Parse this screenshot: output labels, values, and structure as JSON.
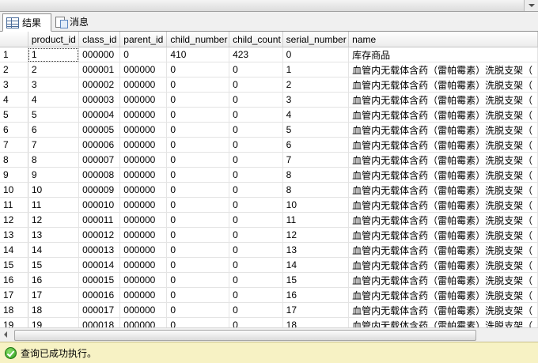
{
  "tabs": [
    {
      "label": "结果",
      "icon": "grid-icon",
      "active": true
    },
    {
      "label": "消息",
      "icon": "message-icon",
      "active": false
    }
  ],
  "results": {
    "columns": [
      "product_id",
      "class_id",
      "parent_id",
      "child_number",
      "child_count",
      "serial_number",
      "name"
    ],
    "rows": [
      [
        "1",
        "1",
        "000000",
        "0",
        "410",
        "423",
        "0",
        "库存商品"
      ],
      [
        "2",
        "2",
        "000001",
        "000000",
        "0",
        "0",
        "1",
        "血管内无载体含药（雷帕霉素）洗脱支架（"
      ],
      [
        "3",
        "3",
        "000002",
        "000000",
        "0",
        "0",
        "2",
        "血管内无载体含药（雷帕霉素）洗脱支架（"
      ],
      [
        "4",
        "4",
        "000003",
        "000000",
        "0",
        "0",
        "3",
        "血管内无载体含药（雷帕霉素）洗脱支架（"
      ],
      [
        "5",
        "5",
        "000004",
        "000000",
        "0",
        "0",
        "4",
        "血管内无载体含药（雷帕霉素）洗脱支架（"
      ],
      [
        "6",
        "6",
        "000005",
        "000000",
        "0",
        "0",
        "5",
        "血管内无载体含药（雷帕霉素）洗脱支架（"
      ],
      [
        "7",
        "7",
        "000006",
        "000000",
        "0",
        "0",
        "6",
        "血管内无载体含药（雷帕霉素）洗脱支架（"
      ],
      [
        "8",
        "8",
        "000007",
        "000000",
        "0",
        "0",
        "7",
        "血管内无载体含药（雷帕霉素）洗脱支架（"
      ],
      [
        "9",
        "9",
        "000008",
        "000000",
        "0",
        "0",
        "8",
        "血管内无载体含药（雷帕霉素）洗脱支架（"
      ],
      [
        "10",
        "10",
        "000009",
        "000000",
        "0",
        "0",
        "8",
        "血管内无载体含药（雷帕霉素）洗脱支架（"
      ],
      [
        "11",
        "11",
        "000010",
        "000000",
        "0",
        "0",
        "10",
        "血管内无载体含药（雷帕霉素）洗脱支架（"
      ],
      [
        "12",
        "12",
        "000011",
        "000000",
        "0",
        "0",
        "11",
        "血管内无载体含药（雷帕霉素）洗脱支架（"
      ],
      [
        "13",
        "13",
        "000012",
        "000000",
        "0",
        "0",
        "12",
        "血管内无载体含药（雷帕霉素）洗脱支架（"
      ],
      [
        "14",
        "14",
        "000013",
        "000000",
        "0",
        "0",
        "13",
        "血管内无载体含药（雷帕霉素）洗脱支架（"
      ],
      [
        "15",
        "15",
        "000014",
        "000000",
        "0",
        "0",
        "14",
        "血管内无载体含药（雷帕霉素）洗脱支架（"
      ],
      [
        "16",
        "16",
        "000015",
        "000000",
        "0",
        "0",
        "15",
        "血管内无载体含药（雷帕霉素）洗脱支架（"
      ],
      [
        "17",
        "17",
        "000016",
        "000000",
        "0",
        "0",
        "16",
        "血管内无载体含药（雷帕霉素）洗脱支架（"
      ],
      [
        "18",
        "18",
        "000017",
        "000000",
        "0",
        "0",
        "17",
        "血管内无载体含药（雷帕霉素）洗脱支架（"
      ],
      [
        "19",
        "19",
        "000018",
        "000000",
        "0",
        "0",
        "18",
        "血管内无载体含药（雷帕霉素）洗脱支架（"
      ]
    ]
  },
  "status": {
    "icon": "success-check-icon",
    "text": "查询已成功执行。"
  },
  "colors": {
    "status_bg": "#f7f2c4",
    "header_bg": "#ececec",
    "success": "#2b9a1c"
  }
}
